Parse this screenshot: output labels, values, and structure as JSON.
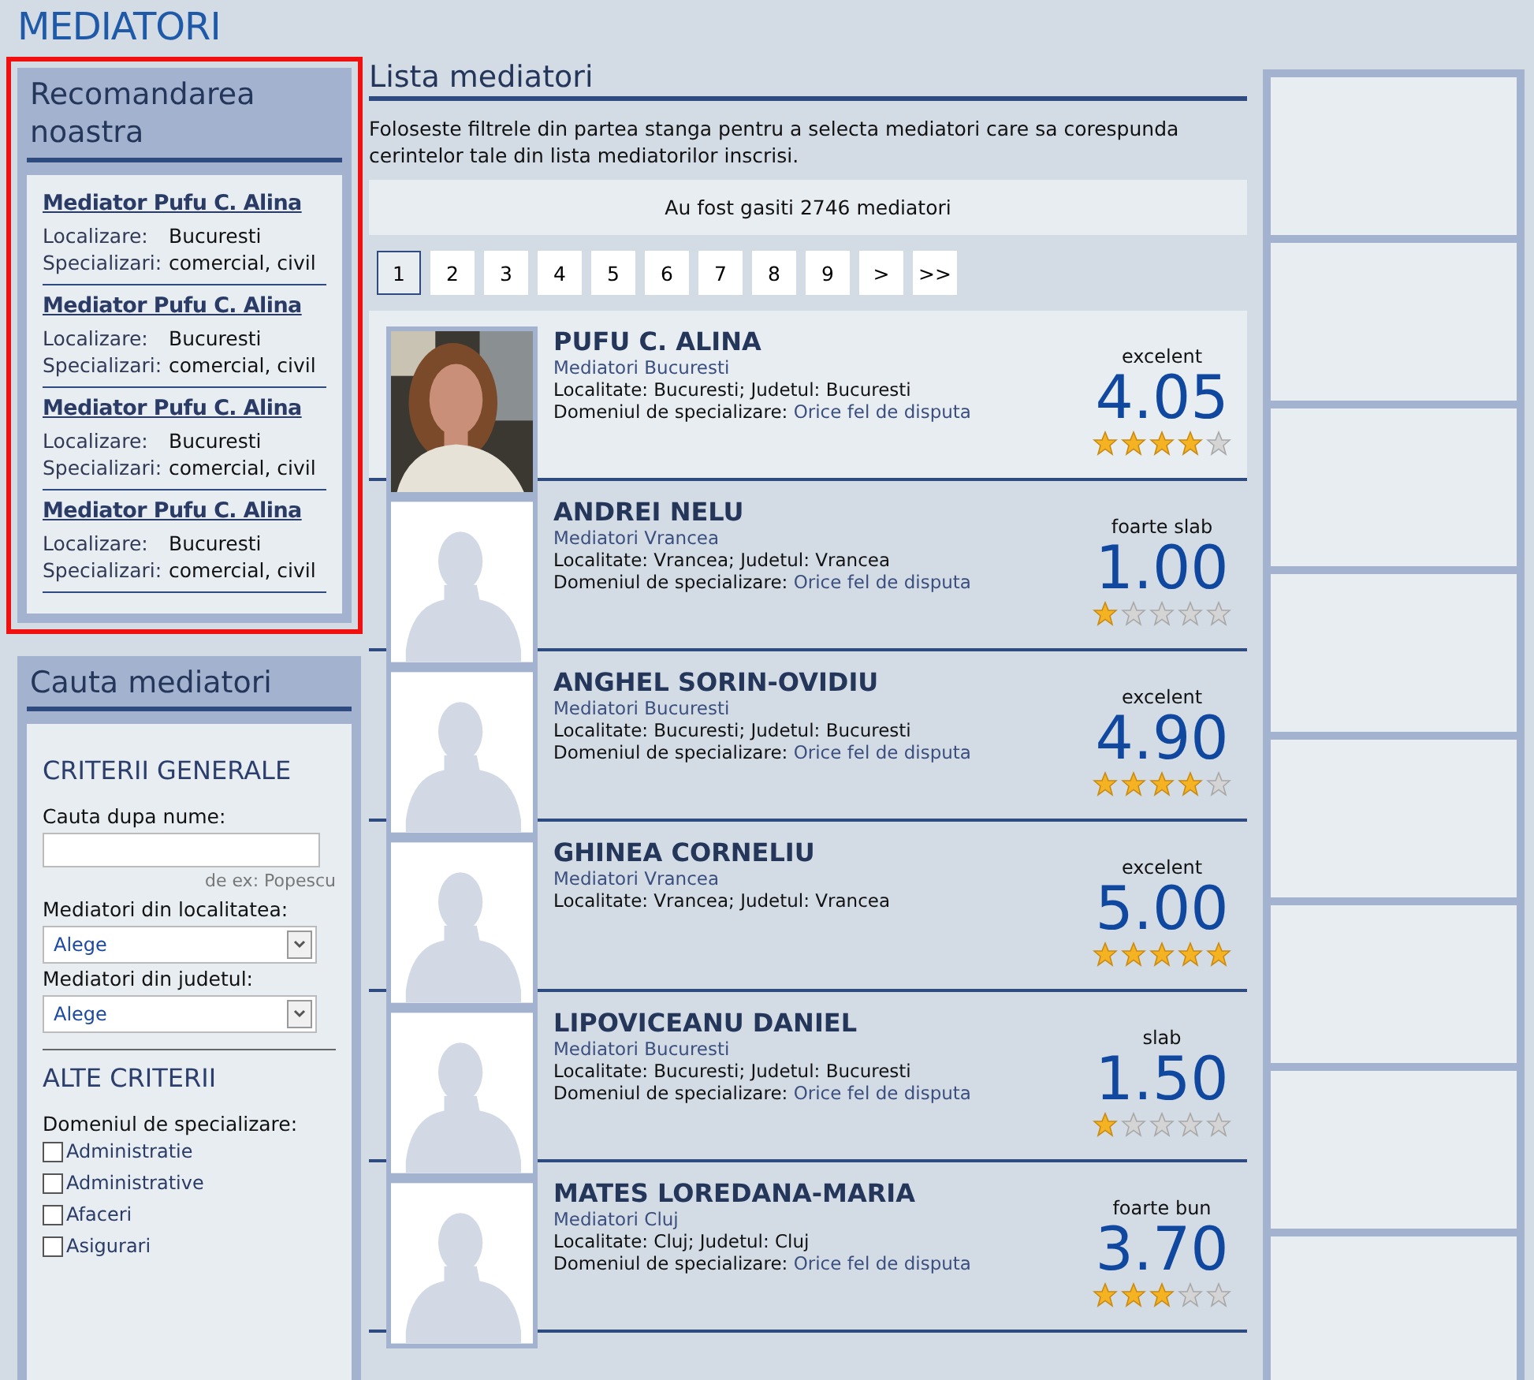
{
  "page_title": "MEDIATORI",
  "recommended": {
    "title": "Recomandarea noastra",
    "highlighted": true,
    "items": [
      {
        "name": "Mediator Pufu C. Alina",
        "location_label": "Localizare:",
        "location": "Bucuresti",
        "spec_label": "Specializari:",
        "spec": "comercial, civil"
      },
      {
        "name": "Mediator Pufu C. Alina",
        "location_label": "Localizare:",
        "location": "Bucuresti",
        "spec_label": "Specializari:",
        "spec": "comercial, civil"
      },
      {
        "name": "Mediator Pufu C. Alina",
        "location_label": "Localizare:",
        "location": "Bucuresti",
        "spec_label": "Specializari:",
        "spec": "comercial, civil"
      },
      {
        "name": "Mediator Pufu C. Alina",
        "location_label": "Localizare:",
        "location": "Bucuresti",
        "spec_label": "Specializari:",
        "spec": "comercial, civil"
      }
    ]
  },
  "search": {
    "title": "Cauta mediatori",
    "general_heading": "CRITERII GENERALE",
    "name_label": "Cauta dupa nume:",
    "name_hint": "de ex: Popescu",
    "selects": [
      {
        "label": "Mediatori din localitatea:",
        "value": "Alege"
      },
      {
        "label": "Mediatori din judetul:",
        "value": "Alege"
      }
    ],
    "other_heading": "ALTE CRITERII",
    "domain_label": "Domeniul de specializare:",
    "domains": [
      {
        "label": "Administratie",
        "checked": false
      },
      {
        "label": "Administrative",
        "checked": false
      },
      {
        "label": "Afaceri",
        "checked": false
      },
      {
        "label": "Asigurari",
        "checked": false
      }
    ]
  },
  "list": {
    "title": "Lista mediatori",
    "intro": "Foloseste filtrele din partea stanga pentru a selecta mediatori care sa corespunda cerintelor tale din lista mediatorilor inscrisi.",
    "count": "Au fost gasiti 2746 mediatori",
    "pages": [
      {
        "label": "1",
        "selected": true
      },
      {
        "label": "2",
        "selected": false
      },
      {
        "label": "3",
        "selected": false
      },
      {
        "label": "4",
        "selected": false
      },
      {
        "label": "5",
        "selected": false
      },
      {
        "label": "6",
        "selected": false
      },
      {
        "label": "7",
        "selected": false
      },
      {
        "label": "8",
        "selected": false
      },
      {
        "label": "9",
        "selected": false
      },
      {
        "label": ">",
        "selected": false
      },
      {
        "label": ">>",
        "selected": false
      }
    ],
    "mediators": [
      {
        "name": "PUFU C. ALINA",
        "group": "Mediatori Bucuresti",
        "place": "Localitate: Bucuresti; Judetul: Bucuresti",
        "domain_label": "Domeniul de specializare:",
        "domain": "Orice fel de disputa",
        "verdict": "excelent",
        "score": "4.05",
        "stars": 4,
        "highlighted": true
      },
      {
        "name": "ANDREI NELU",
        "group": "Mediatori Vrancea",
        "place": "Localitate: Vrancea; Judetul: Vrancea",
        "domain_label": "Domeniul de specializare:",
        "domain": "Orice fel de disputa",
        "verdict": "foarte slab",
        "score": "1.00",
        "stars": 1,
        "photo": {
          "kind": "placeholder"
        },
        "highlighted": false
      },
      {
        "name": "ANGHEL SORIN-OVIDIU",
        "group": "Mediatori Bucuresti",
        "place": "Localitate: Bucuresti; Judetul: Bucuresti",
        "domain_label": "Domeniul de specializare:",
        "domain": "Orice fel de disputa",
        "verdict": "excelent",
        "score": "4.90",
        "stars": 4,
        "photo": {
          "kind": "placeholder"
        },
        "highlighted": false
      },
      {
        "name": "GHINEA CORNELIU",
        "group": "Mediatori Vrancea",
        "place": "Localitate: Vrancea; Judetul: Vrancea",
        "verdict": "excelent",
        "score": "5.00",
        "stars": 5,
        "photo": {
          "kind": "placeholder"
        },
        "highlighted": false
      },
      {
        "name": "LIPOVICEANU DANIEL",
        "group": "Mediatori Bucuresti",
        "place": "Localitate: Bucuresti; Judetul: Bucuresti",
        "domain_label": "Domeniul de specializare:",
        "domain": "Orice fel de disputa",
        "verdict": "slab",
        "score": "1.50",
        "stars": 1,
        "photo": {
          "kind": "placeholder"
        },
        "highlighted": false
      },
      {
        "name": "MATES LOREDANA-MARIA",
        "group": "Mediatori Cluj",
        "place": "Localitate: Cluj; Judetul: Cluj",
        "domain_label": "Domeniul de specializare:",
        "domain": "Orice fel de disputa",
        "verdict": "foarte bun",
        "score": "3.70",
        "stars": 3,
        "photo": {
          "kind": "placeholder"
        },
        "highlighted": false
      }
    ]
  }
}
